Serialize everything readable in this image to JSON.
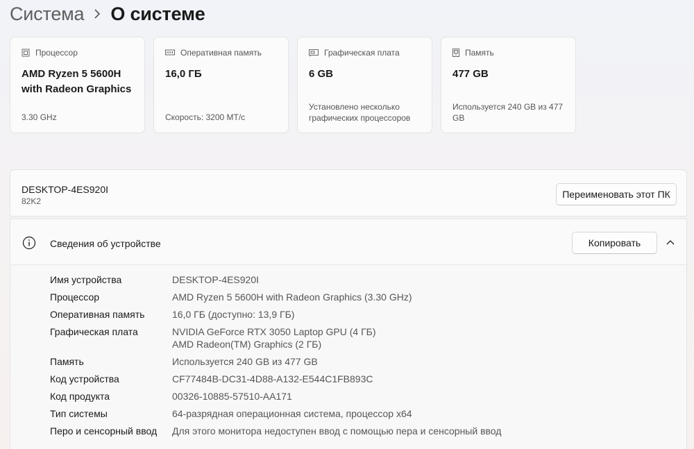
{
  "breadcrumb": {
    "parent": "Система",
    "separator": "›",
    "current": "О системе"
  },
  "cards": [
    {
      "icon": "cpu-icon",
      "label": "Процессор",
      "value": "AMD Ryzen 5 5600H with Radeon Graphics",
      "sub": "3.30 GHz"
    },
    {
      "icon": "memory-icon",
      "label": "Оперативная память",
      "value": "16,0 ГБ",
      "sub": "Скорость: 3200 МТ/с"
    },
    {
      "icon": "gpu-icon",
      "label": "Графическая плата",
      "value": "6 GB",
      "sub": "Установлено несколько графических процессоров"
    },
    {
      "icon": "storage-icon",
      "label": "Память",
      "value": "477 GB",
      "sub": "Используется 240 GB из 477 GB"
    }
  ],
  "device": {
    "name": "DESKTOP-4ES920I",
    "model": "82K2",
    "rename_label": "Переименовать этот ПК"
  },
  "specs": {
    "title": "Сведения об устройстве",
    "copy_label": "Копировать",
    "rows": [
      {
        "label": "Имя устройства",
        "values": [
          "DESKTOP-4ES920I"
        ]
      },
      {
        "label": "Процессор",
        "values": [
          "AMD Ryzen 5 5600H with Radeon Graphics (3.30 GHz)"
        ]
      },
      {
        "label": "Оперативная память",
        "values": [
          "16,0 ГБ (доступно: 13,9 ГБ)"
        ]
      },
      {
        "label": "Графическая плата",
        "values": [
          "NVIDIA GeForce RTX 3050 Laptop GPU (4 ГБ)",
          "AMD Radeon(TM) Graphics (2 ГБ)"
        ]
      },
      {
        "label": "Память",
        "values": [
          "Используется 240 GB из 477 GB"
        ]
      },
      {
        "label": "Код устройства",
        "values": [
          "CF77484B-DC31-4D88-A132-E544C1FB893C"
        ]
      },
      {
        "label": "Код продукта",
        "values": [
          "00326-10885-57510-AA171"
        ]
      },
      {
        "label": "Тип системы",
        "values": [
          "64-разрядная операционная система, процессор x64"
        ]
      },
      {
        "label": "Перо и сенсорный ввод",
        "values": [
          "Для этого монитора недоступен ввод с помощью пера и сенсорный ввод"
        ]
      }
    ]
  }
}
